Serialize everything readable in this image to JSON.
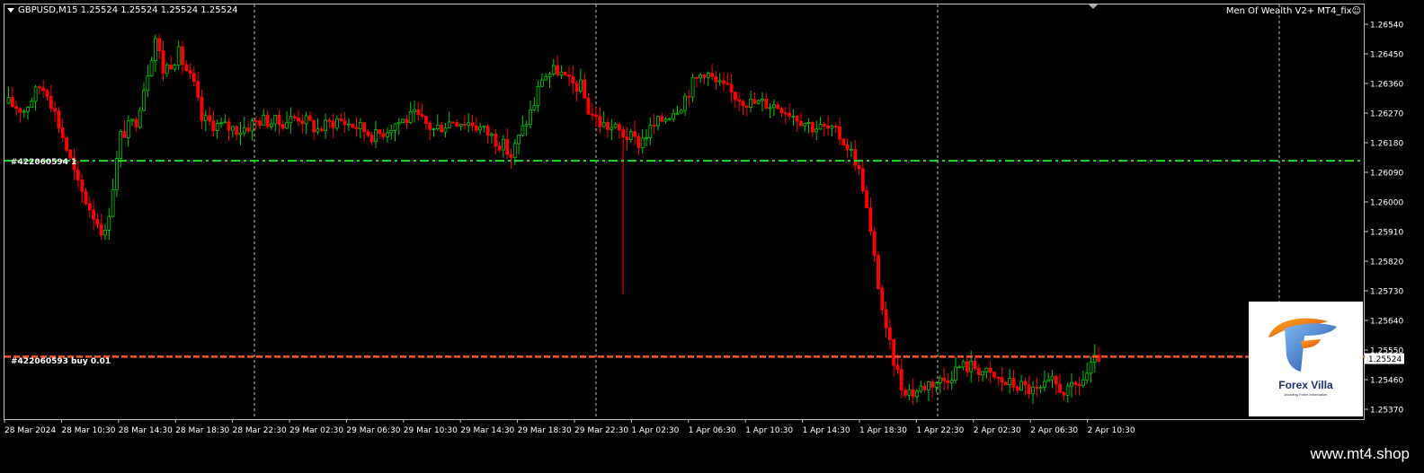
{
  "header": {
    "symbol_line": "GBPUSD,M15  1.25524 1.25524 1.25524 1.25524"
  },
  "indicator": {
    "name": "Men Of Wealth V2+ MT4_fix☺"
  },
  "order_lines": {
    "top_label": "#422060594 1",
    "top_price": 1.26125,
    "bottom_label": "#422060593 buy 0.01",
    "bottom_price": 1.2553
  },
  "logo": {
    "title": "Forex Villa",
    "subtitle": "Avoiding Forex Information"
  },
  "footer": {
    "watermark": "www.mt4.shop"
  },
  "colors": {
    "background": "#000000",
    "bull_candle": "#00cc00",
    "bear_candle": "#ff0000",
    "top_line": "#22dd22",
    "bottom_line": "#ff5522",
    "grid": "#c0c0c0",
    "price_tag_bg": "#ffffff"
  },
  "chart_data": {
    "type": "candlestick",
    "symbol": "GBPUSD",
    "timeframe": "M15",
    "current_price": "1.25524",
    "ylim": [
      1.2534,
      1.266
    ],
    "y_ticks": [
      "1.26540",
      "1.26450",
      "1.26360",
      "1.26270",
      "1.26180",
      "1.26090",
      "1.26000",
      "1.25910",
      "1.25820",
      "1.25730",
      "1.25640",
      "1.25550",
      "1.25460",
      "1.25370"
    ],
    "x_ticks": [
      "28 Mar 2024",
      "28 Mar 10:30",
      "28 Mar 14:30",
      "28 Mar 18:30",
      "28 Mar 22:30",
      "29 Mar 02:30",
      "29 Mar 06:30",
      "29 Mar 10:30",
      "29 Mar 14:30",
      "29 Mar 18:30",
      "29 Mar 22:30",
      "1 Apr 02:30",
      "1 Apr 06:30",
      "1 Apr 10:30",
      "1 Apr 14:30",
      "1 Apr 18:30",
      "1 Apr 22:30",
      "2 Apr 02:30",
      "2 Apr 06:30",
      "2 Apr 10:30"
    ],
    "close_path": [
      [
        0,
        1.263
      ],
      [
        4,
        1.2628
      ],
      [
        8,
        1.2635
      ],
      [
        10,
        1.2634
      ],
      [
        14,
        1.262
      ],
      [
        18,
        1.2605
      ],
      [
        22,
        1.2596
      ],
      [
        25,
        1.259
      ],
      [
        27,
        1.2605
      ],
      [
        29,
        1.262
      ],
      [
        33,
        1.2625
      ],
      [
        36,
        1.264
      ],
      [
        38,
        1.265
      ],
      [
        40,
        1.264
      ],
      [
        44,
        1.2645
      ],
      [
        48,
        1.2635
      ],
      [
        50,
        1.2625
      ],
      [
        55,
        1.2623
      ],
      [
        60,
        1.2622
      ],
      [
        65,
        1.2625
      ],
      [
        70,
        1.2624
      ],
      [
        75,
        1.2626
      ],
      [
        80,
        1.2622
      ],
      [
        85,
        1.2625
      ],
      [
        90,
        1.2623
      ],
      [
        95,
        1.262
      ],
      [
        100,
        1.2624
      ],
      [
        105,
        1.2626
      ],
      [
        110,
        1.2622
      ],
      [
        115,
        1.2625
      ],
      [
        120,
        1.2624
      ],
      [
        125,
        1.262
      ],
      [
        128,
        1.2617
      ],
      [
        130,
        1.2614
      ],
      [
        133,
        1.2622
      ],
      [
        136,
        1.263
      ],
      [
        138,
        1.2638
      ],
      [
        142,
        1.264
      ],
      [
        145,
        1.2636
      ],
      [
        148,
        1.2635
      ],
      [
        150,
        1.2628
      ],
      [
        153,
        1.2624
      ],
      [
        157,
        1.2622
      ],
      [
        160,
        1.262
      ],
      [
        163,
        1.2618
      ],
      [
        166,
        1.2622
      ],
      [
        168,
        1.2624
      ],
      [
        171,
        1.2627
      ],
      [
        174,
        1.263
      ],
      [
        177,
        1.2636
      ],
      [
        180,
        1.264
      ],
      [
        183,
        1.2636
      ],
      [
        187,
        1.2633
      ],
      [
        192,
        1.263
      ],
      [
        196,
        1.263
      ],
      [
        200,
        1.2629
      ],
      [
        204,
        1.2626
      ],
      [
        208,
        1.2623
      ],
      [
        212,
        1.2622
      ],
      [
        215,
        1.262
      ],
      [
        217,
        1.2617
      ],
      [
        219,
        1.2613
      ],
      [
        221,
        1.2605
      ],
      [
        223,
        1.259
      ],
      [
        225,
        1.2575
      ],
      [
        227,
        1.256
      ],
      [
        229,
        1.2552
      ],
      [
        231,
        1.2544
      ],
      [
        234,
        1.2542
      ],
      [
        238,
        1.2545
      ],
      [
        242,
        1.2546
      ],
      [
        246,
        1.255
      ],
      [
        250,
        1.255
      ],
      [
        254,
        1.2547
      ],
      [
        258,
        1.2545
      ],
      [
        262,
        1.2544
      ],
      [
        266,
        1.2542
      ],
      [
        270,
        1.2545
      ],
      [
        274,
        1.2542
      ],
      [
        278,
        1.2546
      ],
      [
        282,
        1.2553
      ]
    ],
    "spike": {
      "bar": 159,
      "low": 1.2572
    },
    "order_lines": [
      {
        "label": "#422060594 1",
        "price": 1.26125,
        "style": "dash-dot",
        "color": "green"
      },
      {
        "label": "#422060593 buy 0.01",
        "price": 1.2553,
        "style": "dashed",
        "color": "orange-red"
      }
    ]
  }
}
